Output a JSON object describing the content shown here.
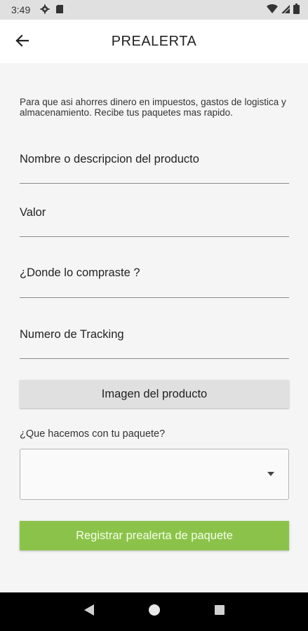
{
  "status_bar": {
    "time": "3:49",
    "icons": [
      "settings-icon",
      "sd-card-icon",
      "wifi-icon",
      "signal-icon",
      "battery-icon"
    ]
  },
  "app_bar": {
    "title": "PREALERTA",
    "back_icon": "arrow-left-icon"
  },
  "form": {
    "intro": "Para que asi ahorres dinero en impuestos, gastos de logistica y almacenamiento. Recibe tus paquetes mas rapido.",
    "fields": [
      {
        "label": "Nombre o descripcion del producto",
        "value": ""
      },
      {
        "label": "Valor",
        "value": ""
      },
      {
        "label": "¿Donde lo compraste ?",
        "value": ""
      },
      {
        "label": "Numero de Tracking",
        "value": ""
      }
    ],
    "image_button": "Imagen del producto",
    "question_label": "¿Que hacemos con tu paquete?",
    "select_value": "",
    "register_button": "Registrar prealerta de paquete"
  },
  "nav_bar": {
    "icons": [
      "back-triangle-icon",
      "home-circle-icon",
      "recents-square-icon"
    ]
  },
  "colors": {
    "accent": "#8bc34a",
    "status_bar": "#e0e0e0",
    "nav_bar": "#000000"
  }
}
